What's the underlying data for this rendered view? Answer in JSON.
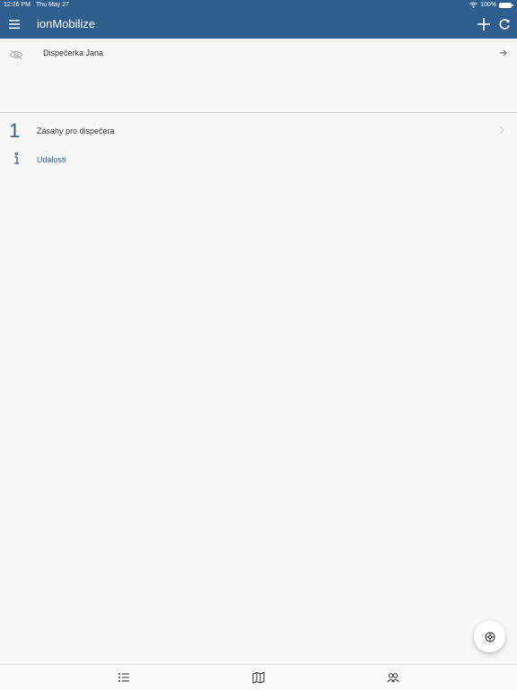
{
  "status_bar": {
    "time": "12:26 PM",
    "date": "Thu May 27",
    "battery": "100%"
  },
  "header": {
    "title": "ionMobilize",
    "icons": [
      "menu-icon",
      "add-icon",
      "refresh-icon"
    ]
  },
  "user": {
    "name": "Dispečerka Jana",
    "icons": [
      "eye-off-icon",
      "arrow-right-icon"
    ]
  },
  "list": {
    "interventions": {
      "count": "1",
      "label": "Zásahy pro dispečera"
    },
    "events": {
      "label": "Události",
      "icon": "info-icon"
    }
  },
  "fab": {
    "icon": "steering-wheel-icon"
  },
  "bottom_tabs": [
    "list-icon",
    "map-icon",
    "people-icon"
  ],
  "colors": {
    "primary": "#2e5f8f",
    "background": "#f8f8f8",
    "text": "#333333"
  }
}
